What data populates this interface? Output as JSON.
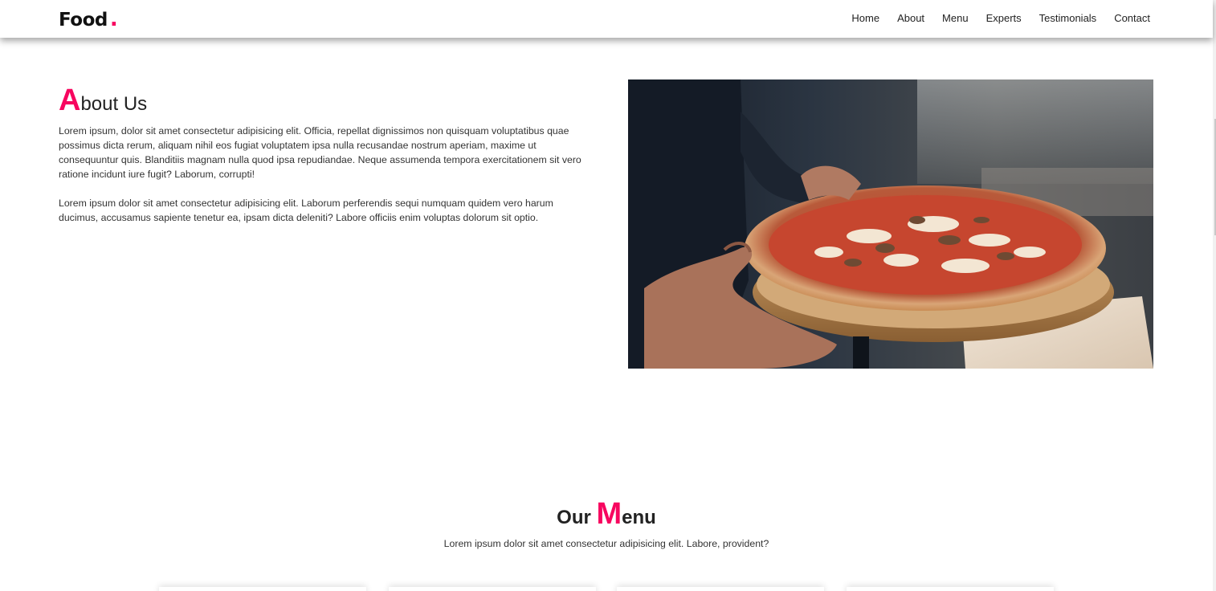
{
  "brand": {
    "name": "Food",
    "dot": ".",
    "accent": "#f7065f"
  },
  "nav": {
    "items": [
      {
        "label": "Home"
      },
      {
        "label": "About"
      },
      {
        "label": "Menu"
      },
      {
        "label": "Experts"
      },
      {
        "label": "Testimonials"
      },
      {
        "label": "Contact"
      }
    ]
  },
  "about": {
    "title_first_letter": "A",
    "title_rest": "bout Us",
    "paragraph_1": "Lorem ipsum, dolor sit amet consectetur adipisicing elit. Officia, repellat dignissimos non quisquam voluptatibus quae possimus dicta rerum, aliquam nihil eos fugiat voluptatem ipsa nulla recusandae nostrum aperiam, maxime ut consequuntur quis. Blanditiis magnam nulla quod ipsa repudiandae. Neque assumenda tempora exercitationem sit vero ratione incidunt iure fugit? Laborum, corrupti!",
    "paragraph_2": "Lorem ipsum dolor sit amet consectetur adipisicing elit. Laborum perferendis sequi numquam quidem vero harum ducimus, accusamus sapiente tenetur ea, ipsam dicta deleniti? Labore officiis enim voluptas dolorum sit optio.",
    "image_subject": "pizza-on-wooden-peel"
  },
  "menu": {
    "title_prefix": "Our ",
    "title_first_letter": "M",
    "title_rest": "enu",
    "subtitle": "Lorem ipsum dolor sit amet consectetur adipisicing elit. Labore, provident?"
  }
}
